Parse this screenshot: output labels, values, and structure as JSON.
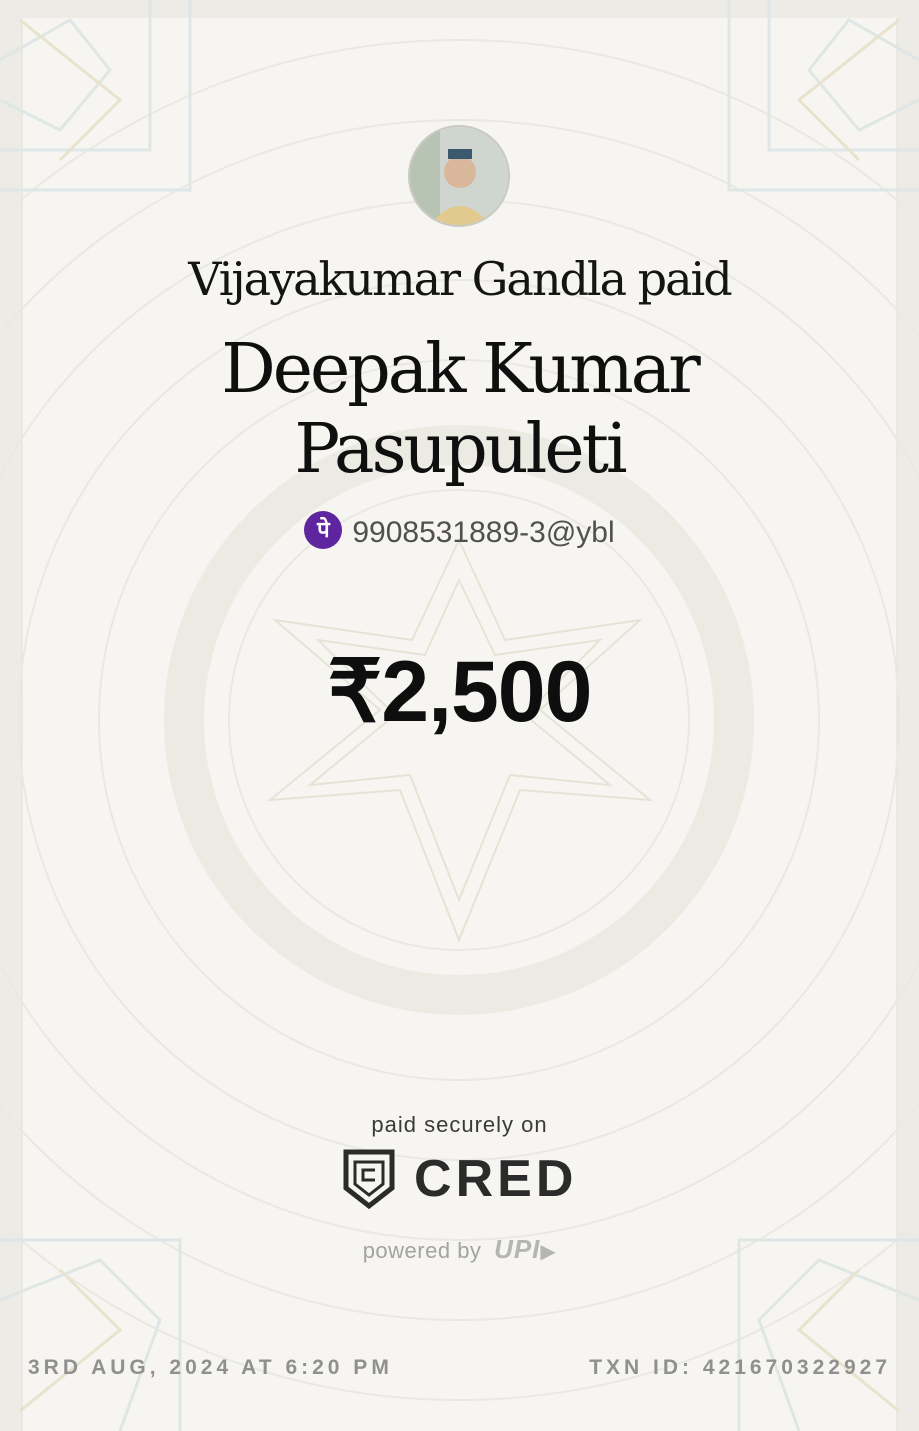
{
  "receipt": {
    "payer_line": "Vijayakumar Gandla paid",
    "payee_line_1": "Deepak Kumar",
    "payee_line_2": "Pasupuleti",
    "upi_app_icon": "phonepe-icon",
    "upi_id": "9908531889-3@ybl",
    "amount": "₹2,500",
    "paid_securely": "paid securely on",
    "cred_brand": "CRED",
    "powered_by": "powered by",
    "upi_brand": "UPI",
    "date": "3RD AUG, 2024 AT 6:20 PM",
    "txn": "TXN ID: 421670322927"
  },
  "colors": {
    "background": "#f6f5f1",
    "phonepe": "#5f259f",
    "text": "#111111"
  }
}
